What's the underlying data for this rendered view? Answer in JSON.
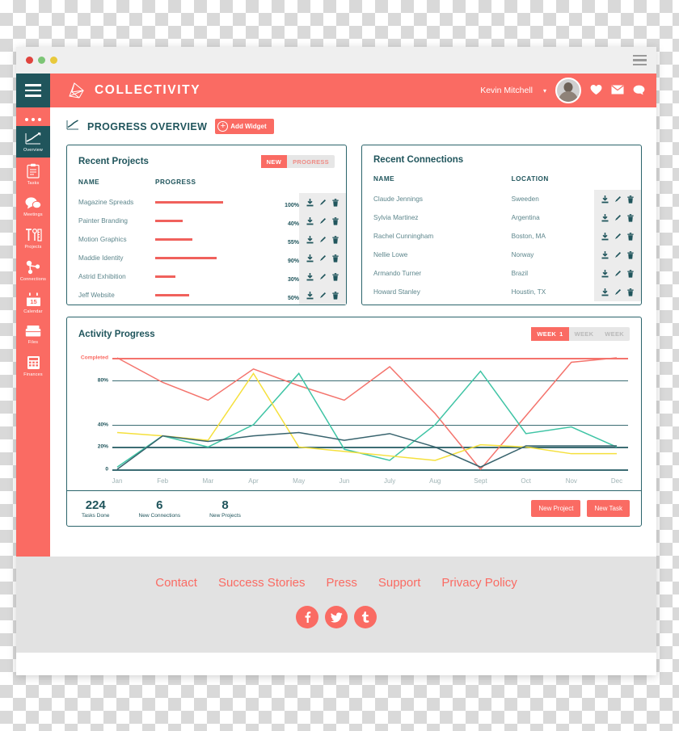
{
  "browser": {
    "dots": [
      {
        "name": "close-dot",
        "color": "#e0443e"
      },
      {
        "name": "minimize-dot",
        "color": "#7cc576"
      },
      {
        "name": "maximize-dot",
        "color": "#e8c93c"
      }
    ],
    "menu_icon": "hamburger-icon"
  },
  "header": {
    "burger_icon": "hamburger-icon",
    "logo_icon": "collectivity-logo-icon",
    "brand": "COLLECTIVITY",
    "user_name": "Kevin Mitchell",
    "caret": "▾",
    "icons": [
      {
        "name": "heart-icon",
        "glyph": "♥"
      },
      {
        "name": "envelope-icon",
        "glyph": "✉"
      },
      {
        "name": "chat-icon",
        "glyph": "●"
      }
    ]
  },
  "sidebar": {
    "items": [
      {
        "label": "Overview",
        "icon": "chart-line-icon",
        "active": true
      },
      {
        "label": "Tasks",
        "icon": "clipboard-icon",
        "active": false
      },
      {
        "label": "Meetings",
        "icon": "speech-bubbles-icon",
        "active": false
      },
      {
        "label": "Projects",
        "icon": "tools-icon",
        "active": false
      },
      {
        "label": "Connections",
        "icon": "network-icon",
        "active": false
      },
      {
        "label": "Calendar",
        "icon": "calendar-icon",
        "active": false,
        "day": "15"
      },
      {
        "label": "Files",
        "icon": "folder-icon",
        "active": false
      },
      {
        "label": "Finances",
        "icon": "calculator-icon",
        "active": false
      }
    ]
  },
  "page": {
    "title": "PROGRESS OVERVIEW",
    "title_icon": "chart-line-icon",
    "add_widget_label": "Add Widget",
    "add_widget_icon": "plus-circle-icon"
  },
  "projects_card": {
    "title": "Recent Projects",
    "toggle": {
      "active": "NEW",
      "inactive": "PROGRESS"
    },
    "columns": [
      "NAME",
      "PROGRESS"
    ],
    "rows": [
      {
        "name": "Magazine Spreads",
        "progress": 100,
        "progress_label": "100%"
      },
      {
        "name": "Painter Branding",
        "progress": 40,
        "progress_label": "40%"
      },
      {
        "name": "Motion Graphics",
        "progress": 55,
        "progress_label": "55%"
      },
      {
        "name": "Maddie Identity",
        "progress": 90,
        "progress_label": "90%"
      },
      {
        "name": "Astrid Exhibition",
        "progress": 30,
        "progress_label": "30%"
      },
      {
        "name": "Jeff Website",
        "progress": 50,
        "progress_label": "50%"
      }
    ],
    "row_actions": [
      {
        "name": "download-icon"
      },
      {
        "name": "edit-pencil-icon"
      },
      {
        "name": "trash-icon"
      }
    ]
  },
  "connections_card": {
    "title": "Recent Connections",
    "columns": [
      "NAME",
      "LOCATION"
    ],
    "rows": [
      {
        "name": "Claude Jennings",
        "location": "Sweeden"
      },
      {
        "name": "Sylvia Martinez",
        "location": "Argentina"
      },
      {
        "name": "Rachel Cunningham",
        "location": "Boston, MA"
      },
      {
        "name": "Nellie Lowe",
        "location": "Norway"
      },
      {
        "name": "Armando Turner",
        "location": "Brazil"
      },
      {
        "name": "Howard Stanley",
        "location": "Houstin, TX"
      }
    ],
    "row_actions": [
      {
        "name": "download-icon"
      },
      {
        "name": "edit-pencil-icon"
      },
      {
        "name": "trash-icon"
      }
    ]
  },
  "activity_card": {
    "title": "Activity Progress",
    "week_tabs": [
      {
        "label": "WEEK",
        "number": "1",
        "active": true
      },
      {
        "label": "WEEK",
        "number": "",
        "active": false
      },
      {
        "label": "WEEK",
        "number": "",
        "active": false
      }
    ]
  },
  "chart_data": {
    "type": "line",
    "title": "Activity Progress",
    "xlabel": "",
    "ylabel": "",
    "grid": true,
    "legend": "none",
    "categories": [
      "Jan",
      "Feb",
      "Mar",
      "Apr",
      "May",
      "Jun",
      "July",
      "Aug",
      "Sept",
      "Oct",
      "Nov",
      "Dec"
    ],
    "x_tick_labels": [
      "Jan",
      "Feb",
      "Mar",
      "Apr",
      "May",
      "Jun",
      "July",
      "Aug",
      "Sept",
      "Oct",
      "Nov",
      "Dec"
    ],
    "y_tick_labels": [
      "Completed",
      "80%",
      "40%",
      "20%",
      "0"
    ],
    "y_tick_values": [
      100,
      80,
      40,
      20,
      0
    ],
    "ylim": [
      0,
      100
    ],
    "series": [
      {
        "name": "series-red",
        "color": "#f4736c",
        "values": [
          100,
          78,
          62,
          90,
          75,
          62,
          92,
          50,
          0,
          48,
          96,
          100
        ]
      },
      {
        "name": "series-teal",
        "color": "#3fc4a5",
        "values": [
          2,
          30,
          20,
          40,
          86,
          18,
          8,
          40,
          88,
          32,
          38,
          20
        ]
      },
      {
        "name": "series-yellow",
        "color": "#f5e03c",
        "values": [
          33,
          30,
          26,
          86,
          20,
          16,
          12,
          8,
          22,
          20,
          14,
          14
        ]
      },
      {
        "name": "series-slate",
        "color": "#37636d",
        "values": [
          0,
          30,
          25,
          30,
          33,
          26,
          32,
          20,
          2,
          21,
          21,
          21
        ]
      }
    ]
  },
  "stats": {
    "items": [
      {
        "number": "224",
        "label": "Tasks Done"
      },
      {
        "number": "6",
        "label": "New Connections"
      },
      {
        "number": "8",
        "label": "New Projects"
      }
    ],
    "buttons": [
      {
        "label": "New Project",
        "name": "new-project-button"
      },
      {
        "label": "New Task",
        "name": "new-task-button"
      }
    ]
  },
  "footer": {
    "links": [
      "Contact",
      "Success Stories",
      "Press",
      "Support",
      "Privacy Policy"
    ],
    "socials": [
      {
        "name": "facebook-icon",
        "glyph": "f"
      },
      {
        "name": "twitter-icon",
        "glyph": "t"
      },
      {
        "name": "tumblr-icon",
        "glyph": "t"
      }
    ]
  }
}
